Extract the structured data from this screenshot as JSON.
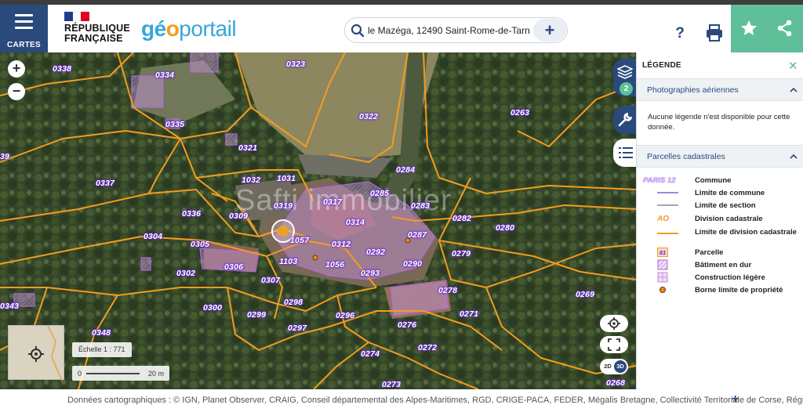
{
  "header": {
    "cartes_label": "CARTES",
    "republique_line1": "RÉPUBLIQUE",
    "republique_line2": "FRANÇAISE",
    "brand_part1": "gé",
    "brand_part2": "o",
    "brand_part3": "portail",
    "search_value": "le Mazéga, 12490 Saint-Rome-de-Tarn",
    "search_icon": "search-icon",
    "search_add": "+",
    "help_label": "?",
    "print_icon": "print-icon",
    "favorite_icon": "star-icon",
    "share_icon": "share-icon",
    "colors": {
      "brand_blue": "#2a4a7c",
      "accent_green": "#5fbf98",
      "geo_blue": "#36a7d9",
      "geo_orange": "#f39c1f"
    }
  },
  "map": {
    "zoom_in": "+",
    "zoom_out": "−",
    "watermark": "Safti immobilier",
    "layers_count": "2",
    "scale_label": "Échelle 1 : 771",
    "scalebar_start": "0",
    "scalebar_end": "20 m",
    "view_2d": "2D",
    "view_3d": "3D",
    "parcel_labels": [
      "0338",
      "0334",
      "0323",
      "0322",
      "0263",
      "0335",
      "0321",
      "0337",
      "0284",
      "1032",
      "1031",
      "0285",
      "0336",
      "0319",
      "0317",
      "0283",
      "0309",
      "0314",
      "0282",
      "0280",
      "0304",
      "1057",
      "0287",
      "0305",
      "0312",
      "0292",
      "0279",
      "0306",
      "1103",
      "1056",
      "0290",
      "0302",
      "0307",
      "0293",
      "0278",
      "0343",
      "0269",
      "0298",
      "0300",
      "0299",
      "0296",
      "0271",
      "0297",
      "0276",
      "0348",
      "0272",
      "0274",
      "0268",
      "0273",
      "39"
    ]
  },
  "legend": {
    "title": "LÉGENDE",
    "close": "✕",
    "section1_title": "Photographies aériennes",
    "section1_text": "Aucune légende n'est disponible pour cette donnée.",
    "section2_title": "Parcelles cadastrales",
    "items": [
      {
        "symbol": "PARIS 12",
        "label": "Commune"
      },
      {
        "symbol": "",
        "label": "Limite de commune"
      },
      {
        "symbol": "",
        "label": "Limite de section"
      },
      {
        "symbol": "AO",
        "label": "Division cadastrale"
      },
      {
        "symbol": "",
        "label": "Limite de division cadastrale"
      },
      {
        "symbol": "81",
        "label": "Parcelle"
      },
      {
        "symbol": "",
        "label": "Bâtiment en dur"
      },
      {
        "symbol": "",
        "label": "Construction légère"
      },
      {
        "symbol": "",
        "label": "Borne limite de propriété"
      }
    ]
  },
  "footer": {
    "attribution": "Données cartographiques : ©    IGN,  Planet Observer,  CRAIG,  Conseil départemental des Alpes-Maritimes,  RGD,  CRIGE-PACA,  FEDER,  Mégalis Bretagne,  Collectivité Territoriale de Corse,  Région Grand",
    "expand": "+"
  }
}
